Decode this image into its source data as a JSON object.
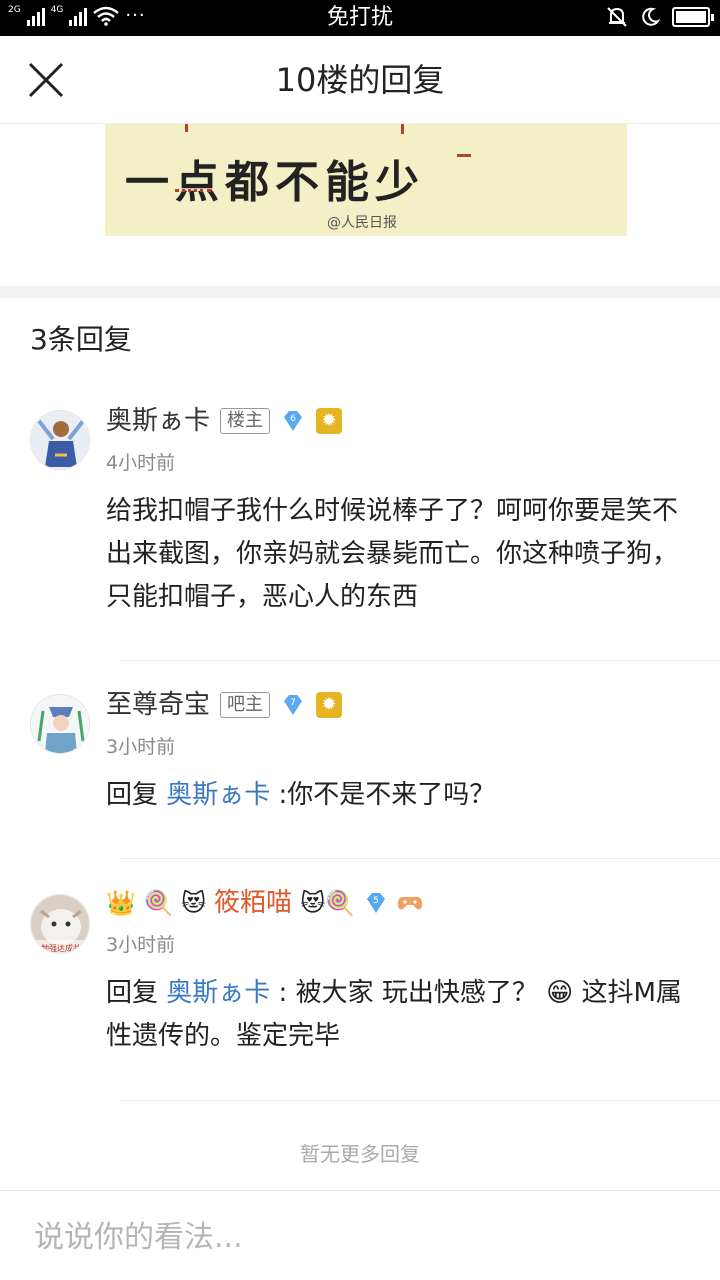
{
  "status_bar": {
    "network_1": "2G",
    "network_2": "4G",
    "more": "···",
    "mode": "免打扰"
  },
  "header": {
    "title": "10楼的回复",
    "close_icon": "close-icon"
  },
  "post_image": {
    "calligraphy": "一点都不能少",
    "watermark": "@人民日报"
  },
  "reply_section": {
    "count_label": "3条回复"
  },
  "replies": [
    {
      "username": "奥斯ぁ卡",
      "role": "楼主",
      "level": "6",
      "time": "4小时前",
      "content": "给我扣帽子我什么时候说棒子了？呵呵你要是笑不出来截图，你亲妈就会暴毙而亡。你这种喷子狗，只能扣帽子，恶心人的东西"
    },
    {
      "username": "至尊奇宝",
      "role": "吧主",
      "level": "7",
      "time": "3小时前",
      "reply_prefix": "回复 ",
      "mention": "奥斯ぁ卡",
      "content": " :你不是不来了吗？"
    },
    {
      "username": "筱粨喵",
      "name_decor_left": "👑 🍭 😻",
      "name_decor_right": "😻🍭",
      "level": "5",
      "time": "3小时前",
      "reply_prefix": "回复 ",
      "mention": "奥斯ぁ卡",
      "content_part1": " : 被大家 玩出快感了？ ",
      "emoji": "😁",
      "content_part2": " 这抖M属性遗传的。鉴定完毕",
      "avatar_caption": "勉强达成共"
    }
  ],
  "footer": {
    "no_more": "暂无更多回复",
    "input_placeholder": "说说你的看法..."
  },
  "colors": {
    "mention": "#3a78c2",
    "fancy_name": "#e0592a",
    "gem": "#5aa9f0",
    "medal": "#e6b422"
  }
}
